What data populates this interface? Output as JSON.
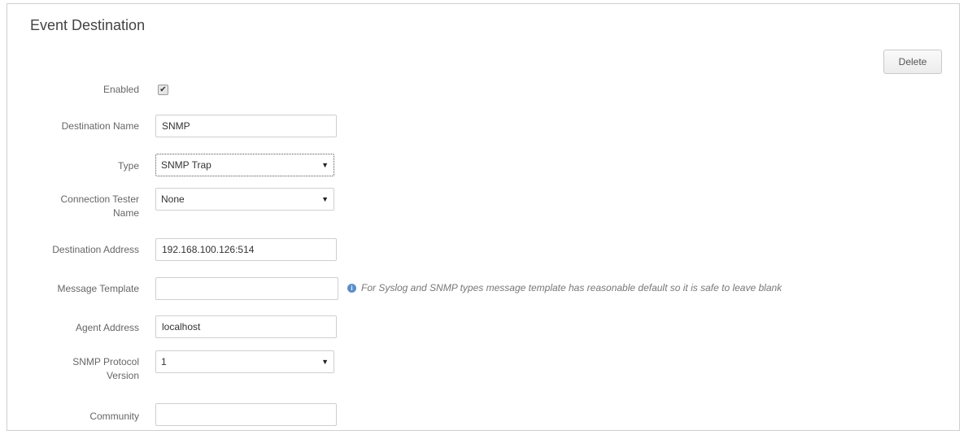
{
  "header": {
    "title": "Event Destination",
    "delete_label": "Delete"
  },
  "form": {
    "enabled": {
      "label": "Enabled",
      "checked": true,
      "check_glyph": "✔"
    },
    "destination_name": {
      "label": "Destination Name",
      "value": "SNMP"
    },
    "type": {
      "label": "Type",
      "value": "SNMP Trap",
      "icon": "chevron-down-icon",
      "caret": "▼"
    },
    "connection_tester_name": {
      "label_line1": "Connection Tester",
      "label_line2": "Name",
      "value": "None",
      "caret": "▼"
    },
    "destination_address": {
      "label": "Destination Address",
      "value": "192.168.100.126:514"
    },
    "message_template": {
      "label": "Message Template",
      "value": "",
      "help_icon": "info-icon",
      "help_text": "For Syslog and SNMP types message template has reasonable default so it is safe to leave blank"
    },
    "agent_address": {
      "label": "Agent Address",
      "value": "localhost"
    },
    "snmp_protocol_version": {
      "label_line1": "SNMP Protocol",
      "label_line2": "Version",
      "value": "1",
      "caret": "▼"
    },
    "community": {
      "label": "Community",
      "value": ""
    }
  },
  "colors": {
    "help_icon": "#5b8fc9",
    "border": "#cfcfcf"
  }
}
